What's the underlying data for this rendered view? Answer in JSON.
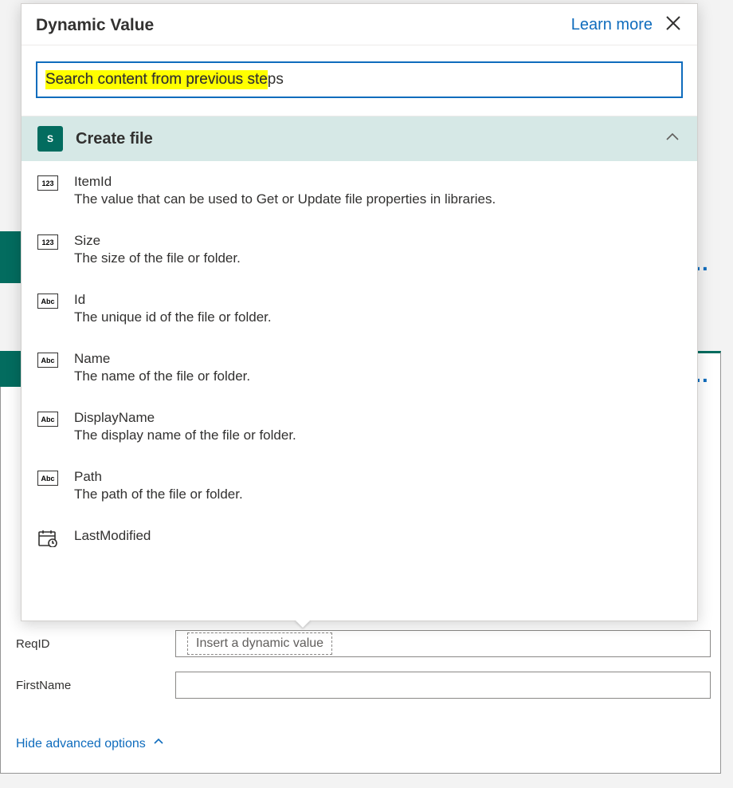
{
  "panel": {
    "title": "Dynamic Value",
    "learn_more": "Learn more",
    "search_highlighted": "Search content from previous ste",
    "search_full": "Search content from previous steps"
  },
  "group": {
    "title": "Create file",
    "icon_letter": "S"
  },
  "items": [
    {
      "type": "123",
      "name": "ItemId",
      "desc": "The value that can be used to Get or Update file properties in libraries."
    },
    {
      "type": "123",
      "name": "Size",
      "desc": "The size of the file or folder."
    },
    {
      "type": "Abc",
      "name": "Id",
      "desc": "The unique id of the file or folder."
    },
    {
      "type": "Abc",
      "name": "Name",
      "desc": "The name of the file or folder."
    },
    {
      "type": "Abc",
      "name": "DisplayName",
      "desc": "The display name of the file or folder."
    },
    {
      "type": "Abc",
      "name": "Path",
      "desc": "The path of the file or folder."
    },
    {
      "type": "cal",
      "name": "LastModified",
      "desc": ""
    }
  ],
  "form": {
    "reqid_label": "ReqID",
    "reqid_placeholder": "Insert a dynamic value",
    "firstname_label": "FirstName",
    "hide_advanced": "Hide advanced options"
  }
}
